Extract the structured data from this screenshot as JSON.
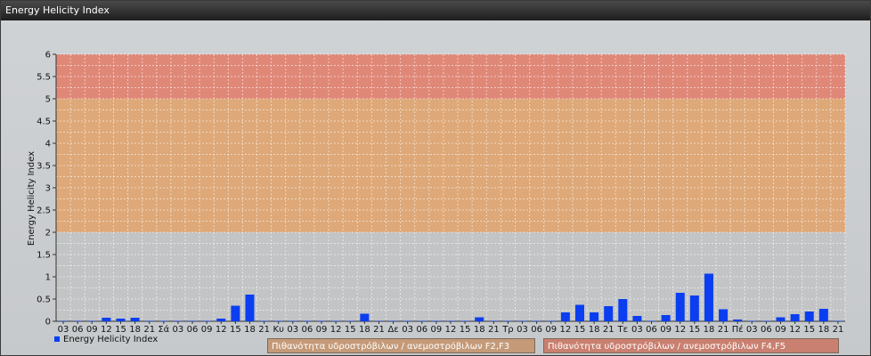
{
  "window": {
    "title": "Energy Helicity Index"
  },
  "chart_data": {
    "type": "bar",
    "ylabel": "Energy Helicity Index",
    "ylim": [
      0,
      6
    ],
    "yticks": [
      "0",
      "0.5",
      "1",
      "1.5",
      "2",
      "2.5",
      "3",
      "3.5",
      "4",
      "4.5",
      "5",
      "5.5",
      "6"
    ],
    "zones": [
      {
        "from": 2,
        "to": 5,
        "color": "#dea878",
        "label": "Πιθανότητα υδροστρόβιλων / ανεμοστρόβιλων F2,F3"
      },
      {
        "from": 5,
        "to": 6,
        "color": "#e08878",
        "label": "Πιθανότητα υδροστρόβιλων / ανεμοστρόβιλων F4,F5"
      }
    ],
    "categories": [
      "03",
      "06",
      "09",
      "12",
      "15",
      "18",
      "21",
      "Σά",
      "03",
      "06",
      "09",
      "12",
      "15",
      "18",
      "21",
      "Κυ",
      "03",
      "06",
      "09",
      "12",
      "15",
      "18",
      "21",
      "Δε",
      "03",
      "06",
      "09",
      "12",
      "15",
      "18",
      "21",
      "Τρ",
      "03",
      "06",
      "09",
      "12",
      "15",
      "18",
      "21",
      "Τε",
      "03",
      "06",
      "09",
      "12",
      "15",
      "18",
      "21",
      "Πέ",
      "03",
      "06",
      "09",
      "12",
      "15",
      "18",
      "21"
    ],
    "series": [
      {
        "name": "Energy Helicity Index",
        "color": "#0a3ef0",
        "values": [
          0.01,
          0.01,
          0.01,
          0.08,
          0.06,
          0.08,
          0.01,
          0.01,
          0.01,
          0.01,
          0.01,
          0.06,
          0.35,
          0.6,
          0.01,
          0.01,
          0.01,
          0.01,
          0.01,
          0.01,
          0.01,
          0.17,
          0.01,
          0.01,
          0.01,
          0.01,
          0.01,
          0.01,
          0.01,
          0.09,
          0.01,
          0.01,
          0.01,
          0.01,
          0.01,
          0.2,
          0.37,
          0.2,
          0.34,
          0.5,
          0.12,
          0.01,
          0.14,
          0.64,
          0.58,
          1.07,
          0.27,
          0.04,
          0.01,
          0.01,
          0.09,
          0.16,
          0.22,
          0.28,
          0.01
        ]
      }
    ]
  }
}
